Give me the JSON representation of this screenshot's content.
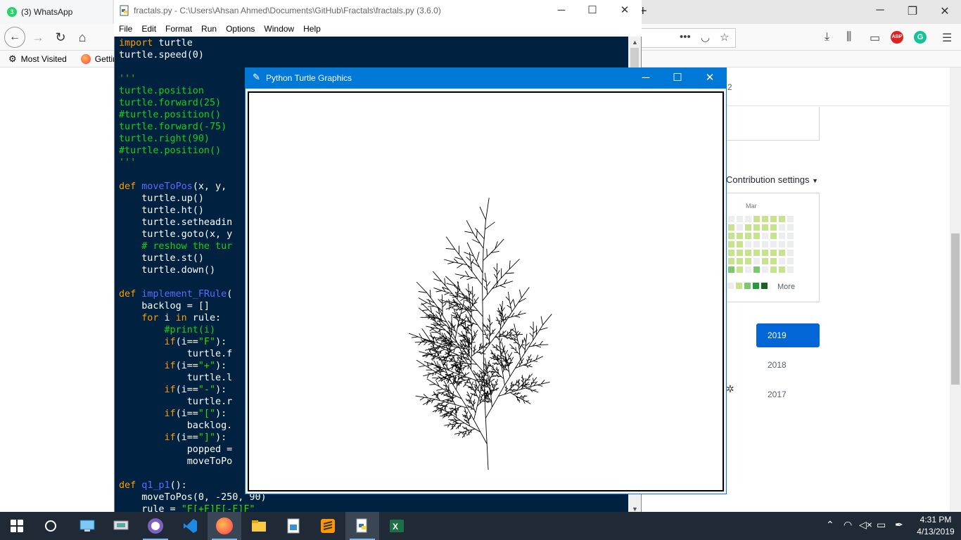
{
  "firefox": {
    "tab_title": "(3) WhatsApp",
    "tab_badge": "3",
    "bookmarks": [
      "Most Visited",
      "Gettin"
    ],
    "github": {
      "counter_tail": "2",
      "contribution_settings": "Contribution settings",
      "month_label": "Mar",
      "more_label": "More",
      "years": [
        "2019",
        "2018",
        "2017"
      ],
      "selected_year": "2019",
      "calendar_colors": [
        "#ebedf0",
        "#c6e48b",
        "#7bc96f",
        "#239a3b",
        "#196127"
      ]
    },
    "abp_label": "ABP",
    "grammarly_label": "G"
  },
  "idle": {
    "title": "fractals.py - C:\\Users\\Ahsan Ahmed\\Documents\\GitHub\\Fractals\\fractals.py (3.6.0)",
    "menu": [
      "File",
      "Edit",
      "Format",
      "Run",
      "Options",
      "Window",
      "Help"
    ],
    "code_lines": [
      "import turtle",
      "turtle.speed(0)",
      "",
      "'''",
      "turtle.position",
      "turtle.forward(25)",
      "#turtle.position()",
      "turtle.forward(-75)",
      "turtle.right(90)",
      "#turtle.position()",
      "'''",
      "",
      "def moveToPos(x, y,",
      "    turtle.up()",
      "    turtle.ht()",
      "    turtle.setheadin",
      "    turtle.goto(x, y",
      "    # reshow the tur",
      "    turtle.st()",
      "    turtle.down()",
      "",
      "def implement_FRule(",
      "    backlog = []",
      "    for i in rule:",
      "        #print(i)",
      "        if(i==\"F\"):",
      "            turtle.f",
      "        if(i==\"+\"):",
      "            turtle.l",
      "        if(i==\"-\"):",
      "            turtle.r",
      "        if(i==\"[\"):",
      "            backlog.",
      "        if(i==\"]\"):",
      "            popped =",
      "            moveToPo",
      "",
      "def q1_p1():",
      "    moveToPos(0, -250, 90)",
      "    rule = \"F[+F]F[-F]F\""
    ]
  },
  "turtle_window": {
    "title": "Python Turtle Graphics"
  },
  "taskbar": {
    "time": "4:31 PM",
    "date": "4/13/2019"
  }
}
